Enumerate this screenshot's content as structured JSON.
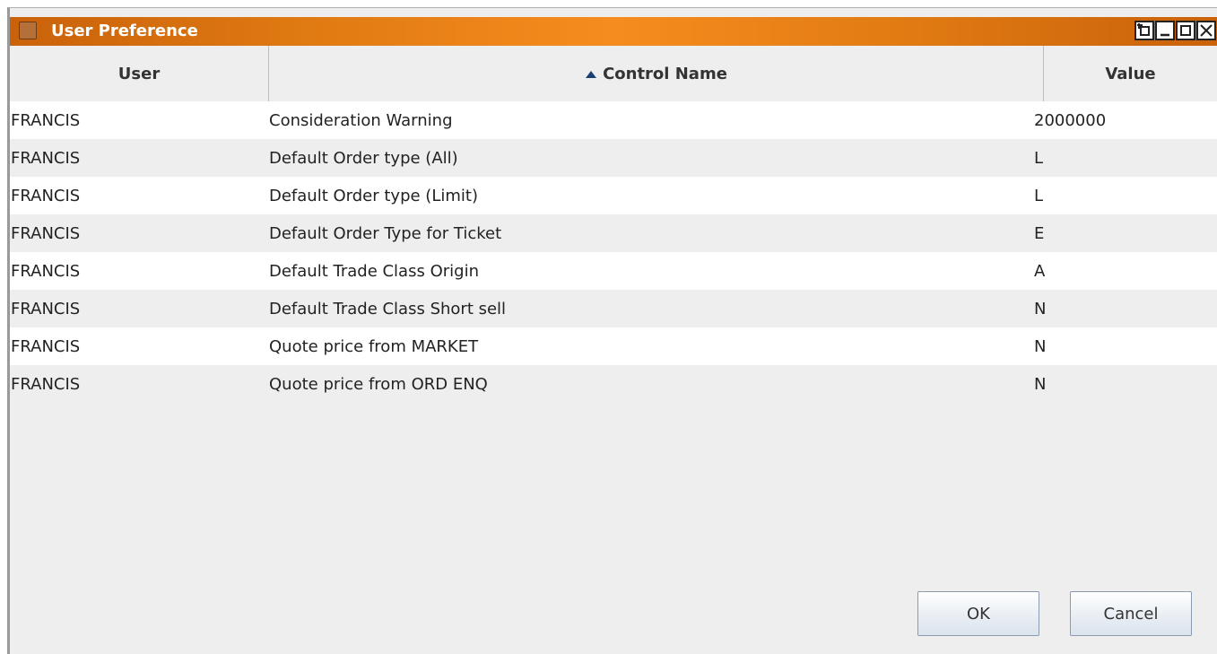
{
  "window": {
    "title": "User Preference",
    "accent_color": "#f58c1f",
    "controls": [
      "detach-icon",
      "minimize-icon",
      "maximize-icon",
      "close-icon"
    ]
  },
  "table": {
    "columns": {
      "user": "User",
      "control": "Control Name",
      "value": "Value"
    },
    "sorted_column": "control",
    "sort_direction": "ascending",
    "rows": [
      {
        "user": "FRANCIS",
        "control": "Consideration Warning",
        "value": "2000000"
      },
      {
        "user": "FRANCIS",
        "control": "Default Order type (All)",
        "value": "L"
      },
      {
        "user": "FRANCIS",
        "control": "Default Order type (Limit)",
        "value": "L"
      },
      {
        "user": "FRANCIS",
        "control": "Default Order Type for Ticket",
        "value": "E"
      },
      {
        "user": "FRANCIS",
        "control": "Default Trade Class Origin",
        "value": "A"
      },
      {
        "user": "FRANCIS",
        "control": "Default Trade Class Short sell",
        "value": "N"
      },
      {
        "user": "FRANCIS",
        "control": "Quote price from MARKET",
        "value": "N"
      },
      {
        "user": "FRANCIS",
        "control": "Quote price from ORD ENQ",
        "value": "N"
      }
    ]
  },
  "buttons": {
    "ok": "OK",
    "cancel": "Cancel"
  }
}
